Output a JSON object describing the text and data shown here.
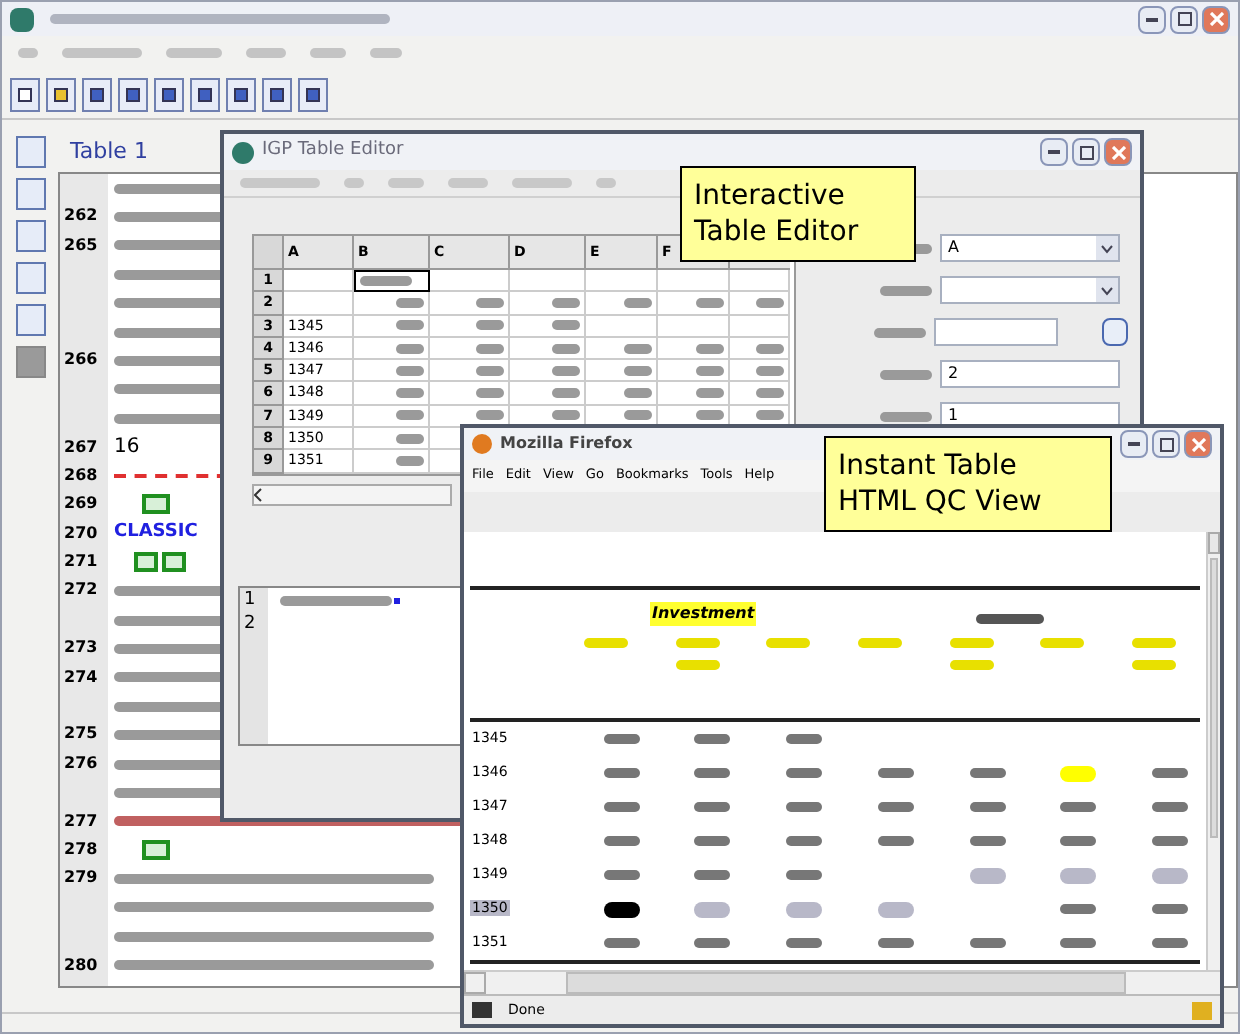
{
  "main_window": {
    "document": {
      "heading": "Table 1",
      "lines": [
        {
          "kind": "text"
        },
        {
          "number": "262",
          "kind": "text"
        },
        {
          "number": "265",
          "kind": "text"
        },
        {
          "kind": "text"
        },
        {
          "kind": "text"
        },
        {
          "kind": "text"
        },
        {
          "number": "266",
          "kind": "text"
        },
        {
          "kind": "text"
        },
        {
          "kind": "text"
        },
        {
          "number": "267",
          "kind": "label",
          "text": "16"
        },
        {
          "number": "268",
          "kind": "dashed"
        },
        {
          "number": "269",
          "kind": "table-icon"
        },
        {
          "number": "270",
          "kind": "label-blue",
          "text": "CLASSIC"
        },
        {
          "number": "271",
          "kind": "double-icon"
        },
        {
          "number": "272",
          "kind": "text"
        },
        {
          "kind": "text"
        },
        {
          "number": "273",
          "kind": "text"
        },
        {
          "number": "274",
          "kind": "text"
        },
        {
          "kind": "text"
        },
        {
          "number": "275",
          "kind": "text"
        },
        {
          "number": "276",
          "kind": "text"
        },
        {
          "kind": "text"
        },
        {
          "number": "277",
          "kind": "caption"
        },
        {
          "number": "278",
          "kind": "table-icon"
        },
        {
          "number": "279",
          "kind": "text"
        },
        {
          "kind": "text"
        },
        {
          "kind": "text"
        },
        {
          "number": "280",
          "kind": "text"
        }
      ]
    }
  },
  "table_editor": {
    "title": "IGP Table Editor",
    "columns": [
      "A",
      "B",
      "C",
      "D",
      "E",
      "F"
    ],
    "rows": [
      {
        "number": "1"
      },
      {
        "number": "2"
      },
      {
        "number": "3",
        "label": "1345"
      },
      {
        "number": "4",
        "label": "1346"
      },
      {
        "number": "5",
        "label": "1347"
      },
      {
        "number": "6",
        "label": "1348"
      },
      {
        "number": "7",
        "label": "1349"
      },
      {
        "number": "8",
        "label": "1350"
      },
      {
        "number": "9",
        "label": "1351"
      }
    ],
    "fields": [
      {
        "kind": "dropdown",
        "value": "A"
      },
      {
        "kind": "dropdown"
      },
      {
        "kind": "button"
      },
      {
        "kind": "text",
        "value": "2"
      },
      {
        "kind": "text",
        "value": "1"
      }
    ],
    "code_lines": [
      "1",
      "2"
    ]
  },
  "callouts": [
    {
      "text": "Interactive Table Editor"
    },
    {
      "text": "Instant Table HTML QC View"
    }
  ],
  "browser": {
    "title": "Mozilla Firefox",
    "menu": [
      "File",
      "Edit",
      "View",
      "Go",
      "Bookmarks",
      "Tools",
      "Help"
    ],
    "group_header": "Investment",
    "rows": [
      {
        "label": "1345",
        "selected": false,
        "cells": [
          {
            "empty": false
          },
          {
            "empty": false
          },
          {
            "empty": false
          },
          {
            "empty": true
          },
          {
            "empty": true
          },
          {
            "empty": true
          },
          {
            "empty": true
          }
        ]
      },
      {
        "label": "1346",
        "selected": false,
        "cells": [
          {
            "empty": false
          },
          {
            "empty": false
          },
          {
            "empty": false
          },
          {
            "empty": false
          },
          {
            "empty": false
          },
          {
            "empty": false,
            "color": "#ffff00"
          },
          {
            "empty": false
          }
        ]
      },
      {
        "label": "1347",
        "selected": false,
        "cells": [
          {
            "empty": false
          },
          {
            "empty": false
          },
          {
            "empty": false
          },
          {
            "empty": false
          },
          {
            "empty": false
          },
          {
            "empty": false
          },
          {
            "empty": false
          }
        ]
      },
      {
        "label": "1348",
        "selected": false,
        "cells": [
          {
            "empty": false
          },
          {
            "empty": false
          },
          {
            "empty": false
          },
          {
            "empty": false
          },
          {
            "empty": false
          },
          {
            "empty": false
          },
          {
            "empty": false
          }
        ]
      },
      {
        "label": "1349",
        "selected": false,
        "cells": [
          {
            "empty": false
          },
          {
            "empty": false
          },
          {
            "empty": false
          },
          {
            "empty": true
          },
          {
            "empty": false,
            "color": "#b8b8c8"
          },
          {
            "empty": false,
            "color": "#b8b8c8"
          },
          {
            "empty": false,
            "color": "#b8b8c8"
          }
        ]
      },
      {
        "label": "1350",
        "selected": true,
        "cells": [
          {
            "empty": false,
            "color": "#000000"
          },
          {
            "empty": false,
            "color": "#b8b8c8"
          },
          {
            "empty": false,
            "color": "#b8b8c8"
          },
          {
            "empty": false,
            "color": "#b8b8c8"
          },
          {
            "empty": true
          },
          {
            "empty": false
          },
          {
            "empty": false
          }
        ]
      },
      {
        "label": "1351",
        "selected": false,
        "cells": [
          {
            "empty": false
          },
          {
            "empty": false
          },
          {
            "empty": false
          },
          {
            "empty": false
          },
          {
            "empty": false
          },
          {
            "empty": false
          },
          {
            "empty": false
          }
        ]
      }
    ],
    "status": "Done"
  }
}
